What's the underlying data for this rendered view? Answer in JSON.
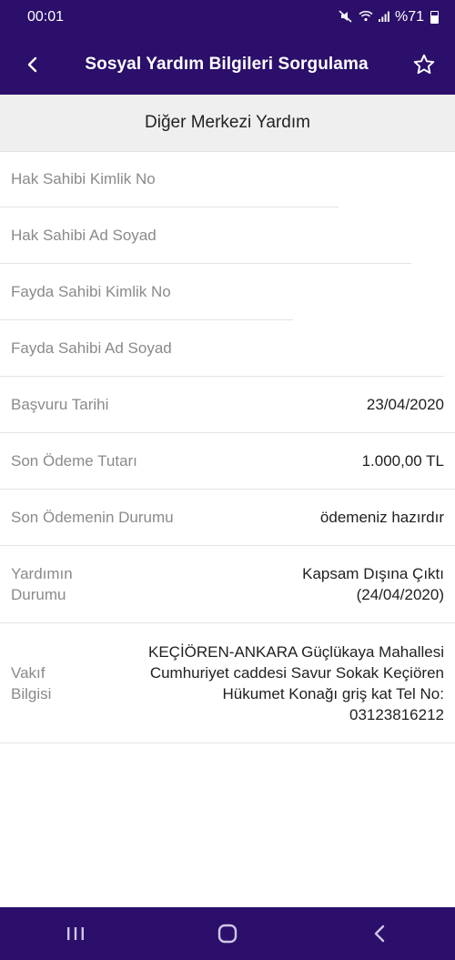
{
  "status_bar": {
    "time": "00:01",
    "battery_percent": "%71"
  },
  "app_bar": {
    "title": "Sosyal Yardım Bilgileri Sorgulama"
  },
  "section": {
    "title": "Diğer Merkezi Yardım"
  },
  "form": {
    "fields": [
      {
        "placeholder": "Hak Sahibi Kimlik No"
      },
      {
        "placeholder": "Hak Sahibi Ad Soyad"
      },
      {
        "placeholder": "Fayda Sahibi Kimlik No"
      },
      {
        "placeholder": "Fayda Sahibi Ad Soyad"
      }
    ]
  },
  "details": {
    "basvuru_tarihi": {
      "label": "Başvuru Tarihi",
      "value": "23/04/2020"
    },
    "son_odeme_tutari": {
      "label": "Son Ödeme Tutarı",
      "value": "1.000,00 TL"
    },
    "son_odeme_durumu": {
      "label": "Son Ödemenin Durumu",
      "value": "ödemeniz hazırdır"
    },
    "yardim_durumu": {
      "label_lines": [
        "Yardımın",
        "Durumu"
      ],
      "value_lines": [
        "Kapsam Dışına Çıktı",
        "(24/04/2020)"
      ]
    },
    "vakif_bilgisi": {
      "label_lines": [
        "Vakıf",
        "Bilgisi"
      ],
      "value_lines": [
        "KEÇİÖREN-ANKARA Güçlükaya Mahallesi",
        "Cumhuriyet caddesi Savur Sokak Keçiören",
        "Hükumet Konağı griş kat Tel No:",
        "03123816212"
      ]
    }
  },
  "colors": {
    "primary": "#2b0f6b",
    "header_bg": "#efefef",
    "label": "#8a8a8a"
  }
}
